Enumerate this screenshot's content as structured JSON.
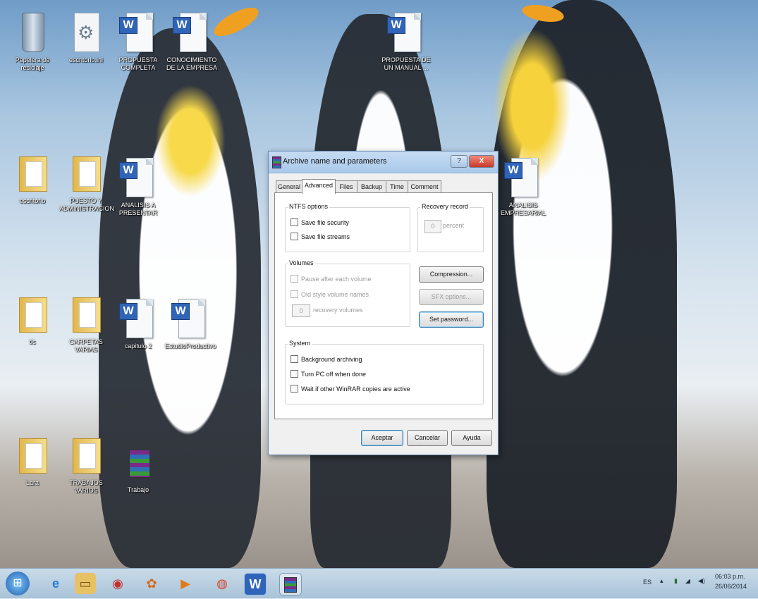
{
  "desktop": {
    "icons": [
      {
        "id": "recycle",
        "label": "Papelera de\nreciclaje",
        "type": "bin"
      },
      {
        "id": "config",
        "label": "escritorio.ini",
        "type": "cfg"
      },
      {
        "id": "doc1",
        "label": "PROPUESTA\nCOMPLETA",
        "type": "word"
      },
      {
        "id": "doc2",
        "label": "CONOCIMIENTO\nDE LA EMPRESA",
        "type": "word"
      },
      {
        "id": "doc3",
        "label": "PROPUESTA DE\nUN MANUAL ...",
        "type": "word"
      },
      {
        "id": "folder1",
        "label": "escritorio",
        "type": "folder"
      },
      {
        "id": "folder2",
        "label": "PUESTO Y\nADMINISTRACION",
        "type": "folder"
      },
      {
        "id": "doc4",
        "label": "ANALISIS A\nPRESENTAR",
        "type": "word"
      },
      {
        "id": "doc5",
        "label": "ANALISIS\nEMPRESARIAL",
        "type": "word"
      },
      {
        "id": "folder3",
        "label": "tic",
        "type": "folder"
      },
      {
        "id": "folder4",
        "label": "CARPETAS\nVARIAS",
        "type": "folder"
      },
      {
        "id": "doc6",
        "label": "capitulo 2",
        "type": "word"
      },
      {
        "id": "doc7",
        "label": "EstudioProductivo",
        "type": "word"
      },
      {
        "id": "folder5",
        "label": "Lara",
        "type": "folder"
      },
      {
        "id": "folder6",
        "label": "TRABAJOS\nVARIOS",
        "type": "folder"
      },
      {
        "id": "rar1",
        "label": "Trabajo",
        "type": "rar"
      }
    ]
  },
  "dialog": {
    "title": "Archive name and parameters",
    "help_btn": "?",
    "close_btn": "X",
    "tabs": [
      "General",
      "Advanced",
      "Files",
      "Backup",
      "Time",
      "Comment"
    ],
    "ntfs": {
      "title": "NTFS options",
      "save_security": "Save file security",
      "save_streams": "Save file streams"
    },
    "recovery": {
      "title": "Recovery record",
      "value": "0",
      "unit": "percent"
    },
    "volumes": {
      "title": "Volumes",
      "pause": "Pause after each volume",
      "old_style": "Old style volume names",
      "recovery_count": "0",
      "recovery_label": "recovery volumes"
    },
    "buttons_side": {
      "compression": "Compression...",
      "sfx": "SFX options...",
      "set_password": "Set password..."
    },
    "system": {
      "title": "System",
      "background": "Background archiving",
      "turn_off": "Turn PC off when done",
      "wait": "Wait if other WinRAR copies are active"
    },
    "footer": {
      "ok": "Aceptar",
      "cancel": "Cancelar",
      "help": "Ayuda"
    }
  },
  "taskbar": {
    "language": "ES",
    "time": "06:03 p.m.",
    "date": "26/06/2014"
  },
  "colors": {
    "taskbar": "#b9cfe0",
    "dialog_title": "#b7d2ee",
    "close": "#d9493f"
  }
}
